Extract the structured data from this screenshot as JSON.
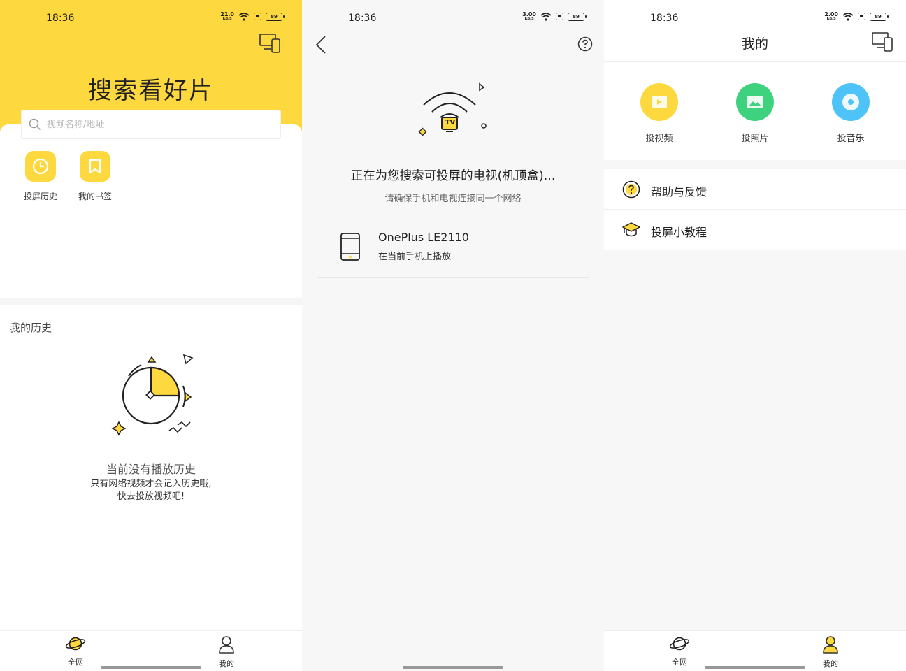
{
  "status": [
    {
      "time": "18:36",
      "speed": "21.0",
      "speed_unit": "KB/S",
      "battery": "89"
    },
    {
      "time": "18:36",
      "speed": "3.00",
      "speed_unit": "KB/S",
      "battery": "89"
    },
    {
      "time": "18:36",
      "speed": "2.00",
      "speed_unit": "KB/S",
      "battery": "89"
    }
  ],
  "home": {
    "title": "搜索看好片",
    "search_placeholder": "视频名称/地址",
    "quick": [
      {
        "label": "投屏历史",
        "icon": "clock-icon"
      },
      {
        "label": "我的书签",
        "icon": "bookmark-icon"
      }
    ],
    "history_title": "我的历史",
    "empty_main": "当前没有播放历史",
    "empty_sub_1": "只有网络视频才会记入历史哦,",
    "empty_sub_2": "快去投放视频吧!"
  },
  "tabs": [
    {
      "label": "全网",
      "icon": "planet-icon"
    },
    {
      "label": "我的",
      "icon": "user-icon"
    }
  ],
  "scan": {
    "title": "正在为您搜索可投屏的电视(机顶盒)...",
    "subtitle": "请确保手机和电视连接同一个网络",
    "tv_badge": "TV",
    "device_name": "OnePlus  LE2110",
    "device_desc": "在当前手机上播放"
  },
  "mine": {
    "title": "我的",
    "cast_items": [
      {
        "label": "投视频",
        "color": "#fdd83f",
        "icon": "video-icon"
      },
      {
        "label": "投照片",
        "color": "#3ed27f",
        "icon": "photo-icon"
      },
      {
        "label": "投音乐",
        "color": "#4ec3f7",
        "icon": "music-disc-icon"
      }
    ],
    "menu": [
      {
        "label": "帮助与反馈",
        "icon": "help-icon"
      },
      {
        "label": "投屏小教程",
        "icon": "graduation-cap-icon"
      }
    ]
  },
  "colors": {
    "accent": "#fdd83f",
    "green": "#3ed27f",
    "blue": "#4ec3f7"
  }
}
